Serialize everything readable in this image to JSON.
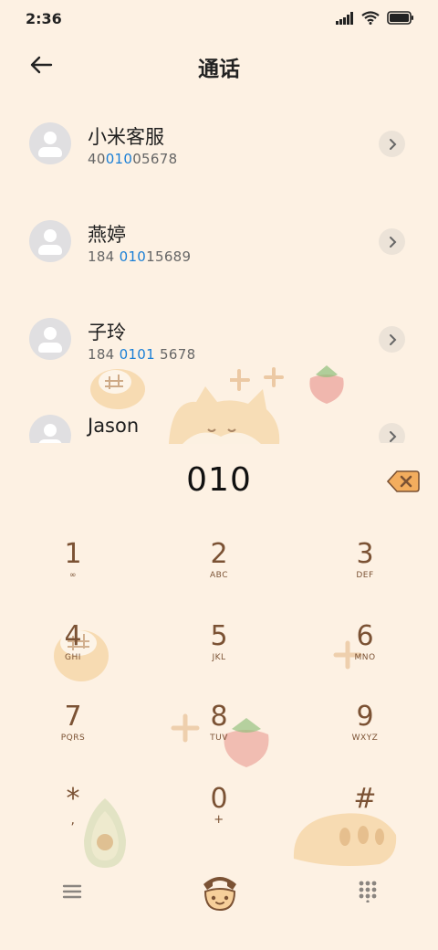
{
  "status_bar": {
    "time": "2:36"
  },
  "header": {
    "title": "通话"
  },
  "contacts": [
    {
      "name": "小米客服",
      "number_pre": "40",
      "number_hl": "010",
      "number_post": "05678"
    },
    {
      "name": "燕婷",
      "number_pre": "184 ",
      "number_hl": "010",
      "number_post": "15689"
    },
    {
      "name": "子玲",
      "number_pre": "184 ",
      "number_hl": "0101",
      "number_post": " 5678"
    },
    {
      "name": "Jason",
      "number_pre": "",
      "number_hl": "",
      "number_post": ""
    }
  ],
  "dialer": {
    "input": "010",
    "keys": [
      {
        "digit": "1",
        "letters": "∞"
      },
      {
        "digit": "2",
        "letters": "ABC"
      },
      {
        "digit": "3",
        "letters": "DEF"
      },
      {
        "digit": "4",
        "letters": "GHI"
      },
      {
        "digit": "5",
        "letters": "JKL"
      },
      {
        "digit": "6",
        "letters": "MNO"
      },
      {
        "digit": "7",
        "letters": "PQRS"
      },
      {
        "digit": "8",
        "letters": "TUV"
      },
      {
        "digit": "9",
        "letters": "WXYZ"
      },
      {
        "digit": "*",
        "letters": ","
      },
      {
        "digit": "0",
        "letters": "+"
      },
      {
        "digit": "#",
        "letters": ""
      }
    ]
  },
  "colors": {
    "background": "#fdf1e3",
    "keypad_brown": "#7b5234",
    "highlight_blue": "#1a7fd6",
    "backspace_orange": "#f3ad5e"
  },
  "icons": {
    "back": "arrow-left-icon",
    "detail": "chevron-right-icon",
    "backspace": "backspace-icon",
    "menu": "menu-icon",
    "call": "telephone-icon",
    "dialpad": "dialpad-grid-icon"
  }
}
